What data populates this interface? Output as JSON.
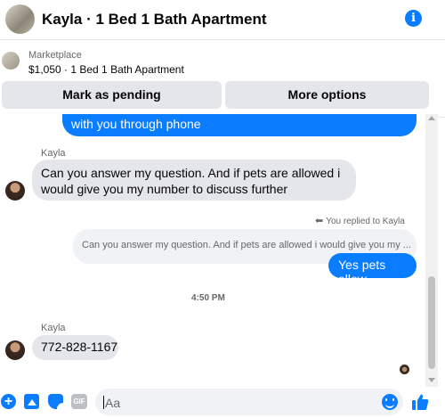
{
  "header": {
    "title": "Kayla · 1 Bed 1 Bath Apartment",
    "info_glyph": "i"
  },
  "marketplace": {
    "label": "Marketplace",
    "listing": "$1,050 · 1 Bed 1 Bath Apartment",
    "pending_button": "Mark as pending",
    "more_button": "More options"
  },
  "messages": {
    "top_bubble": "with you through phone",
    "sender1": "Kayla",
    "question": "Can you answer my question. And if pets are allowed i would give you my number to discuss further",
    "replied_label": "You replied to Kayla",
    "replied_arrow": "⬅",
    "quoted": "Can you answer my question. And if pets are allowed i would give you my ...",
    "reply": "Yes pets allow",
    "timestamp": "4:50 PM",
    "sender2": "Kayla",
    "phone": "772-828-1167"
  },
  "composer": {
    "placeholder": "Aa",
    "plus_glyph": "+",
    "gif_label": "GIF"
  },
  "colors": {
    "accent": "#0a7cff",
    "bubble_in": "#e4e6eb",
    "muted_text": "#65676b"
  },
  "icons": [
    "info-icon",
    "plus-icon",
    "photo-icon",
    "sticker-icon",
    "gif-icon",
    "emoji-icon",
    "thumbs-up-icon"
  ]
}
